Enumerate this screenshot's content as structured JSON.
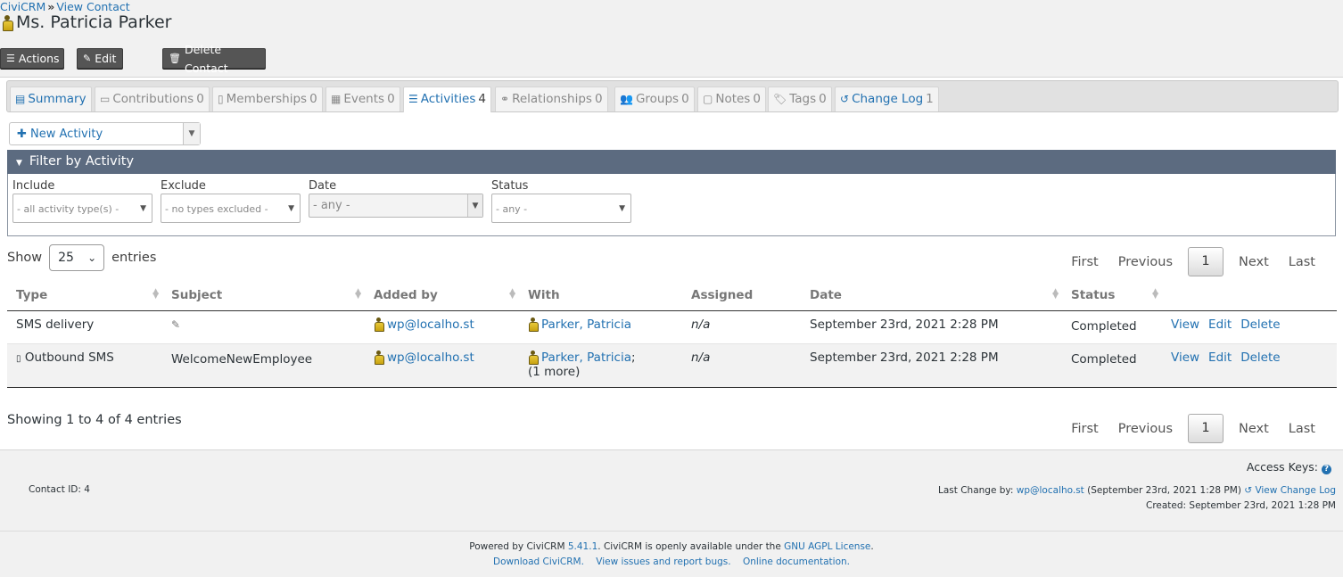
{
  "breadcrumb": {
    "home": "CiviCRM",
    "sep": "»",
    "current": "View Contact"
  },
  "contact": {
    "name": "Ms. Patricia Parker"
  },
  "actions": {
    "actions_label": "Actions",
    "edit_label": "Edit",
    "delete_label": "Delete Contact"
  },
  "tabs": [
    {
      "label": "Summary",
      "count": "",
      "icon": "id-card-icon"
    },
    {
      "label": "Contributions",
      "count": "0",
      "icon": "credit-card-icon"
    },
    {
      "label": "Memberships",
      "count": "0",
      "icon": "badge-icon"
    },
    {
      "label": "Events",
      "count": "0",
      "icon": "calendar-icon"
    },
    {
      "label": "Activities",
      "count": "4",
      "icon": "list-icon"
    },
    {
      "label": "Relationships",
      "count": "0",
      "icon": "handshake-icon"
    },
    {
      "label": "Groups",
      "count": "0",
      "icon": "users-icon"
    },
    {
      "label": "Notes",
      "count": "0",
      "icon": "note-icon"
    },
    {
      "label": "Tags",
      "count": "0",
      "icon": "tags-icon"
    },
    {
      "label": "Change Log",
      "count": "1",
      "icon": "history-icon"
    }
  ],
  "new_activity": {
    "label": "New Activity"
  },
  "filter": {
    "title": "Filter by Activity",
    "include_label": "Include",
    "include_value": "- all activity type(s) -",
    "exclude_label": "Exclude",
    "exclude_value": "- no types excluded -",
    "date_label": "Date",
    "date_value": "- any -",
    "status_label": "Status",
    "status_value": "- any -"
  },
  "table_controls": {
    "show": "Show",
    "entries": "entries",
    "page_length": "25"
  },
  "pager": {
    "first": "First",
    "previous": "Previous",
    "page": "1",
    "next": "Next",
    "last": "Last"
  },
  "columns": [
    "Type",
    "Subject",
    "Added by",
    "With",
    "Assigned",
    "Date",
    "Status"
  ],
  "rows": [
    {
      "type": "SMS delivery",
      "subject": "",
      "added_by": "wp@localho.st",
      "with": "Parker, Patricia",
      "with_extra": "",
      "assigned": "n/a",
      "date": "September 23rd, 2021 2:28 PM",
      "status": "Completed",
      "view": "View",
      "edit": "Edit",
      "delete": "Delete"
    },
    {
      "type": "Outbound SMS",
      "subject": "WelcomeNewEmployee",
      "added_by": "wp@localho.st",
      "with": "Parker, Patricia",
      "with_extra": "(1 more)",
      "assigned": "n/a",
      "date": "September 23rd, 2021 2:28 PM",
      "status": "Completed",
      "view": "View",
      "edit": "Edit",
      "delete": "Delete"
    }
  ],
  "showing": "Showing 1 to 4 of 4 entries",
  "footer": {
    "access_keys": "Access Keys:",
    "contact_id": "Contact ID: 4",
    "last_change_prefix": "Last Change by:",
    "last_change_user": "wp@localho.st",
    "last_change_date": "(September 23rd, 2021 1:28 PM)",
    "view_change_log": "View Change Log",
    "created": "Created: September 23rd, 2021 1:28 PM",
    "powered_prefix": "Powered by CiviCRM",
    "version": "5.41.1",
    "powered_mid": ". CiviCRM is openly available under the",
    "license": "GNU AGPL License",
    "download": "Download CiviCRM.",
    "issues": "View issues and report bugs.",
    "docs": "Online documentation."
  }
}
